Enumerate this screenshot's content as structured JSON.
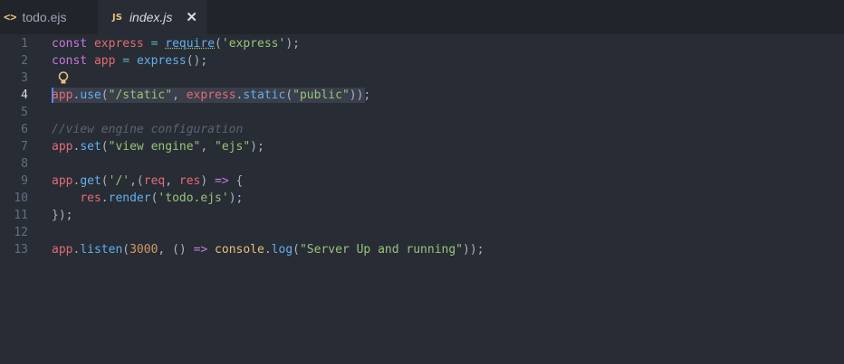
{
  "tabs": [
    {
      "icon": "<>",
      "label": "todo.ejs",
      "active": false
    },
    {
      "icon": "JS",
      "label": "index.js",
      "active": true,
      "close": "✕"
    }
  ],
  "current_line": 4,
  "lines": [
    {
      "num": "1",
      "tokens": [
        {
          "t": "const ",
          "c": "kw"
        },
        {
          "t": "express",
          "c": "var"
        },
        {
          "t": " = ",
          "c": "op"
        },
        {
          "t": "require",
          "c": "fn",
          "squiggle": true
        },
        {
          "t": "(",
          "c": "pl"
        },
        {
          "t": "'express'",
          "c": "str"
        },
        {
          "t": ");",
          "c": "pl"
        }
      ]
    },
    {
      "num": "2",
      "tokens": [
        {
          "t": "const ",
          "c": "kw"
        },
        {
          "t": "app",
          "c": "var"
        },
        {
          "t": " = ",
          "c": "op"
        },
        {
          "t": "express",
          "c": "fn"
        },
        {
          "t": "();",
          "c": "pl"
        }
      ]
    },
    {
      "num": "3",
      "tokens": [],
      "bulb": true
    },
    {
      "num": "4",
      "tokens": [
        {
          "t": "app",
          "c": "var"
        },
        {
          "t": ".",
          "c": "pl"
        },
        {
          "t": "use",
          "c": "fn"
        },
        {
          "t": "(",
          "c": "pl"
        },
        {
          "t": "\"/static\"",
          "c": "str"
        },
        {
          "t": ", ",
          "c": "pl"
        },
        {
          "t": "express",
          "c": "var"
        },
        {
          "t": ".",
          "c": "pl"
        },
        {
          "t": "static",
          "c": "fn"
        },
        {
          "t": "(",
          "c": "pl"
        },
        {
          "t": "\"public\"",
          "c": "str"
        },
        {
          "t": "));",
          "c": "pl"
        }
      ],
      "highlight": true
    },
    {
      "num": "5",
      "tokens": []
    },
    {
      "num": "6",
      "tokens": [
        {
          "t": "//view engine configuration",
          "c": "cmt"
        }
      ]
    },
    {
      "num": "7",
      "tokens": [
        {
          "t": "app",
          "c": "var"
        },
        {
          "t": ".",
          "c": "pl"
        },
        {
          "t": "set",
          "c": "fn"
        },
        {
          "t": "(",
          "c": "pl"
        },
        {
          "t": "\"view engine\"",
          "c": "str"
        },
        {
          "t": ", ",
          "c": "pl"
        },
        {
          "t": "\"ejs\"",
          "c": "str"
        },
        {
          "t": ");",
          "c": "pl"
        }
      ]
    },
    {
      "num": "8",
      "tokens": []
    },
    {
      "num": "9",
      "tokens": [
        {
          "t": "app",
          "c": "var"
        },
        {
          "t": ".",
          "c": "pl"
        },
        {
          "t": "get",
          "c": "fn"
        },
        {
          "t": "(",
          "c": "pl"
        },
        {
          "t": "'/'",
          "c": "str"
        },
        {
          "t": ",(",
          "c": "pl"
        },
        {
          "t": "req",
          "c": "var"
        },
        {
          "t": ", ",
          "c": "pl"
        },
        {
          "t": "res",
          "c": "var"
        },
        {
          "t": ") ",
          "c": "pl"
        },
        {
          "t": "=>",
          "c": "kw"
        },
        {
          "t": " {",
          "c": "pl"
        }
      ]
    },
    {
      "num": "10",
      "tokens": [
        {
          "t": "    ",
          "c": "pl"
        },
        {
          "t": "res",
          "c": "var"
        },
        {
          "t": ".",
          "c": "pl"
        },
        {
          "t": "render",
          "c": "fn"
        },
        {
          "t": "(",
          "c": "pl"
        },
        {
          "t": "'todo.ejs'",
          "c": "str"
        },
        {
          "t": ");",
          "c": "pl"
        }
      ]
    },
    {
      "num": "11",
      "tokens": [
        {
          "t": "});",
          "c": "pl"
        }
      ]
    },
    {
      "num": "12",
      "tokens": []
    },
    {
      "num": "13",
      "tokens": [
        {
          "t": "app",
          "c": "var"
        },
        {
          "t": ".",
          "c": "pl"
        },
        {
          "t": "listen",
          "c": "fn"
        },
        {
          "t": "(",
          "c": "pl"
        },
        {
          "t": "3000",
          "c": "num"
        },
        {
          "t": ", () ",
          "c": "pl"
        },
        {
          "t": "=>",
          "c": "kw"
        },
        {
          "t": " ",
          "c": "pl"
        },
        {
          "t": "console",
          "c": "cls"
        },
        {
          "t": ".",
          "c": "pl"
        },
        {
          "t": "log",
          "c": "fn"
        },
        {
          "t": "(",
          "c": "pl"
        },
        {
          "t": "\"Server Up and running\"",
          "c": "str"
        },
        {
          "t": "));",
          "c": "pl"
        }
      ]
    }
  ],
  "colors": {
    "background": "#282c34",
    "tabbar": "#21252b",
    "keyword": "#c678dd",
    "variable": "#e06c75",
    "function": "#61afef",
    "string": "#98c379",
    "number": "#d19a66",
    "comment": "#5c6370"
  }
}
